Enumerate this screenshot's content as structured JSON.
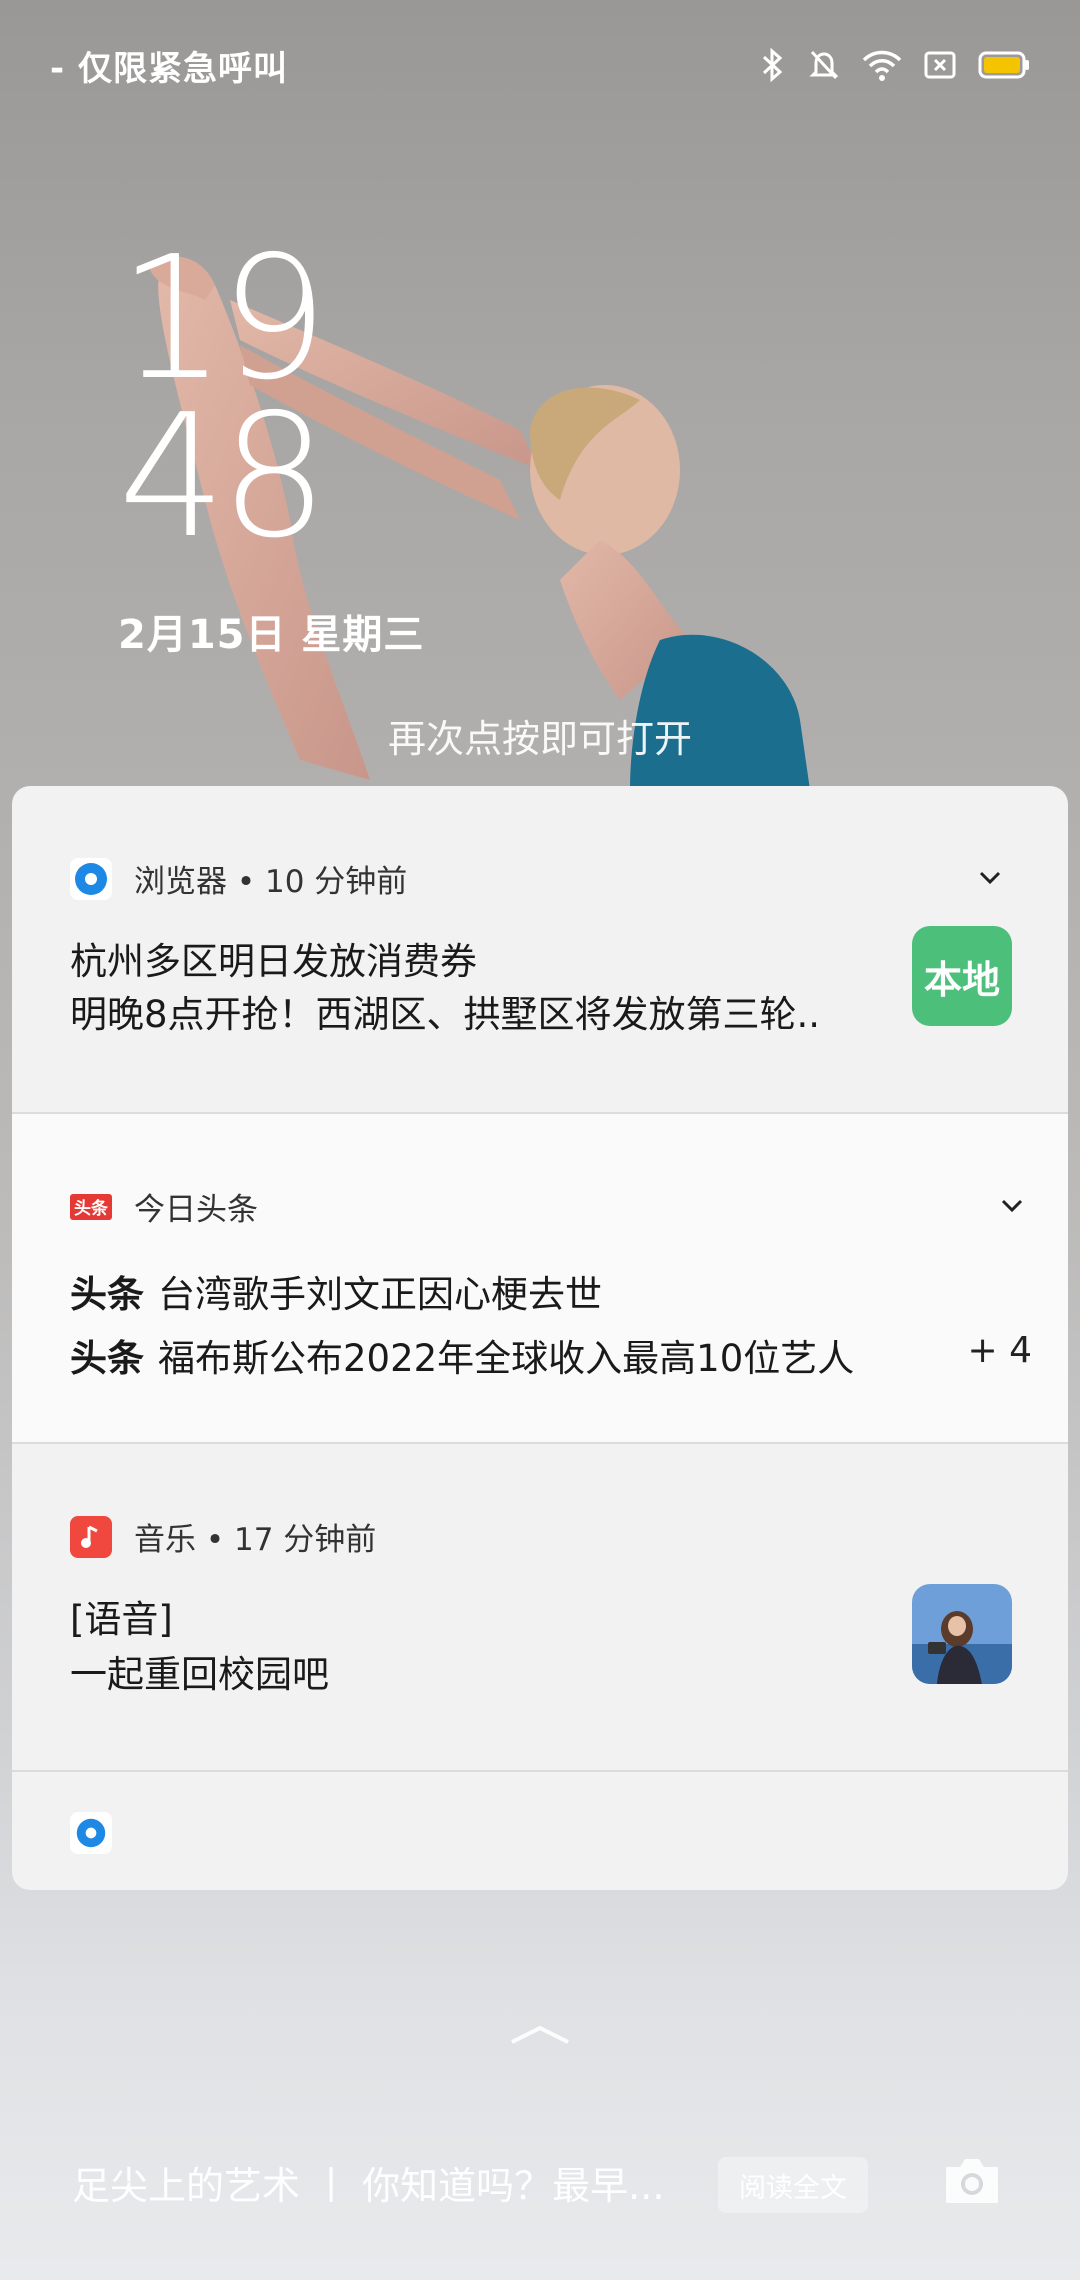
{
  "status_bar": {
    "carrier": "- 仅限紧急呼叫",
    "icons": [
      "bluetooth-icon",
      "mute-bell-icon",
      "wifi-icon",
      "no-sim-icon",
      "battery-icon"
    ],
    "battery_color": "#f5c400"
  },
  "lockscreen": {
    "hour": "19",
    "minute": "48",
    "date": "2月15日  星期三",
    "tap_hint": "再次点按即可打开"
  },
  "notifications": [
    {
      "app": "浏览器 • 10 分钟前",
      "icon": "browser-icon",
      "title": "杭州多区明日发放消费券",
      "text": "明晚8点开抢！西湖区、拱墅区将发放第三轮..",
      "thumb_label": "本地",
      "thumb_color": "#4cbf7a"
    },
    {
      "app": "今日头条",
      "icon": "toutiao-icon",
      "lines": [
        {
          "tag": "头条",
          "text": "台湾歌手刘文正因心梗去世"
        },
        {
          "tag": "头条",
          "text": "福布斯公布2022年全球收入最高10位艺人"
        }
      ],
      "more": "+ 4"
    },
    {
      "app": "音乐 • 17 分钟前",
      "icon": "music-icon",
      "title": "[语音]",
      "text": "一起重回校园吧"
    },
    {
      "icon": "browser-icon"
    }
  ],
  "footer": {
    "ticker": "足尖上的艺术 丨 你知道吗？最早...",
    "read_button": "阅读全文"
  }
}
